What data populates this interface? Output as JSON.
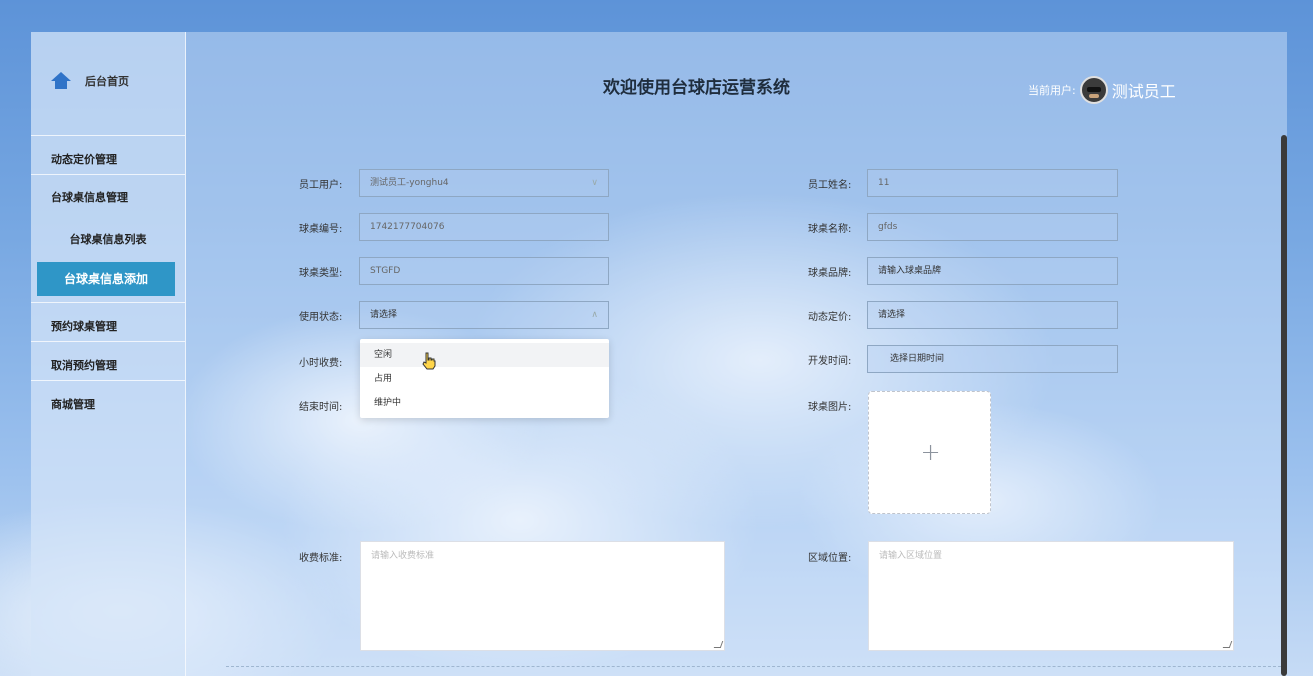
{
  "header": {
    "title": "欢迎使用台球店运营系统",
    "user_label": "当前用户:",
    "user_name": "测试员工"
  },
  "sidebar": {
    "home": "后台首页",
    "items": [
      {
        "label": "动态定价管理"
      },
      {
        "label": "台球桌信息管理"
      },
      {
        "label": "台球桌信息列表"
      },
      {
        "label": "台球桌信息添加"
      },
      {
        "label": "预约球桌管理"
      },
      {
        "label": "取消预约管理"
      },
      {
        "label": "商城管理"
      }
    ]
  },
  "form": {
    "employee_user": {
      "label": "员工用户:",
      "value": "测试员工-yonghu4"
    },
    "employee_name": {
      "label": "员工姓名:",
      "value": "11"
    },
    "table_no": {
      "label": "球桌编号:",
      "value": "1742177704076"
    },
    "table_name": {
      "label": "球桌名称:",
      "value": "gfds"
    },
    "table_type": {
      "label": "球桌类型:",
      "value": "STGFD"
    },
    "table_brand": {
      "label": "球桌品牌:",
      "value": "请输入球桌品牌"
    },
    "usage_status": {
      "label": "使用状态:",
      "value": "请选择"
    },
    "dynamic_price": {
      "label": "动态定价:",
      "value": "请选择"
    },
    "hourly_fee": {
      "label": "小时收费:"
    },
    "open_time": {
      "label": "开发时间:",
      "value": "选择日期时间"
    },
    "end_time": {
      "label": "结束时间:"
    },
    "table_image": {
      "label": "球桌图片:"
    },
    "fee_standard": {
      "label": "收费标准:",
      "placeholder": "请输入收费标准"
    },
    "area_location": {
      "label": "区域位置:",
      "placeholder": "请输入区域位置"
    }
  },
  "status_options": [
    "空闲",
    "占用",
    "维护中"
  ],
  "colors": {
    "active_menu": "#2f96c7",
    "home_icon": "#2f73c8"
  },
  "icons": {
    "home": "home-icon",
    "avatar": "avatar",
    "upload": "plus-icon",
    "cursor": "hand-pointer-icon"
  }
}
